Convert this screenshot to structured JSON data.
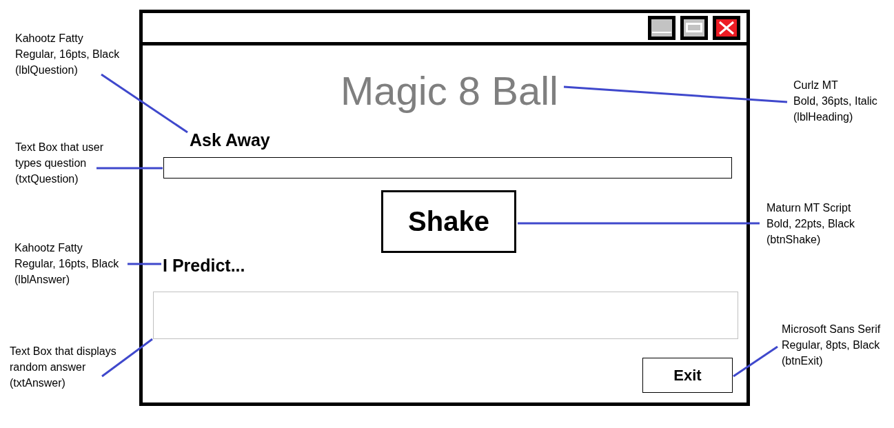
{
  "window": {
    "title_bar_buttons": [
      {
        "kind": "minimize"
      },
      {
        "kind": "maximize"
      },
      {
        "kind": "close"
      }
    ],
    "heading": {
      "text": "Magic 8 Ball",
      "note": "Curlz MT\nBold, 36pts, Italic\n(lblHeading)"
    },
    "question_label": {
      "text": "Ask Away",
      "note": "Kahootz Fatty\nRegular, 16pts, Black\n(lblQuestion)"
    },
    "question_field": {
      "note": "Text Box that user\ntypes question\n(txtQuestion)"
    },
    "shake_button": {
      "text": "Shake",
      "note": "Maturn MT Script\nBold, 22pts, Black\n(btnShake)"
    },
    "answer_label": {
      "text": "I Predict...",
      "note": "Kahootz Fatty\nRegular, 16pts, Black\n(lblAnswer)"
    },
    "answer_field": {
      "note": "Text Box that displays\nrandom answer\n(txtAnswer)"
    },
    "exit_button": {
      "text": "Exit",
      "note": "Microsoft Sans Serif\nRegular, 8pts, Black\n(btnExit)"
    }
  }
}
